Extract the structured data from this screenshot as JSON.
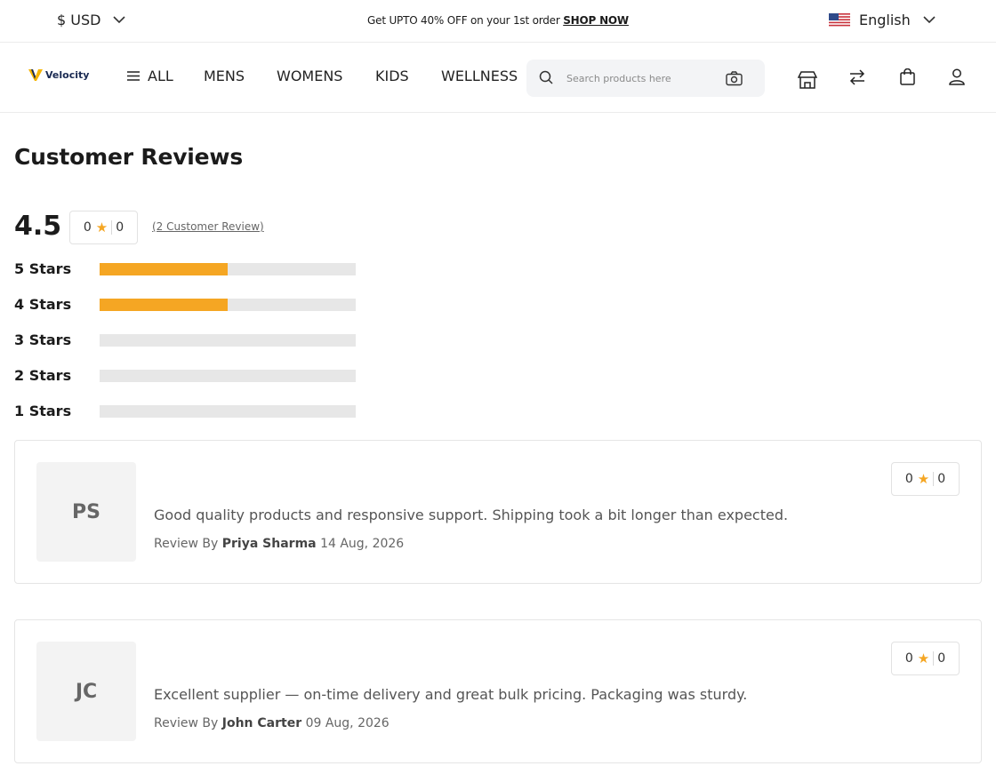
{
  "topbar": {
    "currency": "$ USD",
    "promo_text": "Get UPTO 40% OFF on your 1st order",
    "promo_link": "SHOP NOW",
    "language": "English"
  },
  "nav": {
    "brand": "Velocity",
    "all_label": "ALL",
    "items": [
      "MENS",
      "WOMENS",
      "KIDS",
      "WELLNESS"
    ],
    "search_placeholder": "Search products here"
  },
  "reviews": {
    "title": "Customer Reviews",
    "average": "4.5",
    "summary_votes": {
      "up": "0",
      "down": "0"
    },
    "count_text": "(2 Customer Review)",
    "breakdown": [
      {
        "label": "5 Stars",
        "fraction": 0.5
      },
      {
        "label": "4 Stars",
        "fraction": 0.5
      },
      {
        "label": "3 Stars",
        "fraction": 0
      },
      {
        "label": "2 Stars",
        "fraction": 0
      },
      {
        "label": "1 Stars",
        "fraction": 0
      }
    ],
    "items": [
      {
        "initials": "PS",
        "text": "Good quality products and responsive support. Shipping took a bit longer than expected.",
        "by_label": "Review By",
        "author": "Priya Sharma",
        "date": "14 Aug, 2026",
        "votes": {
          "up": "0",
          "down": "0"
        }
      },
      {
        "initials": "JC",
        "text": "Excellent supplier — on-time delivery and great bulk pricing. Packaging was sturdy.",
        "by_label": "Review By",
        "author": "John Carter",
        "date": "09 Aug, 2026",
        "votes": {
          "up": "0",
          "down": "0"
        }
      }
    ]
  },
  "colors": {
    "accent": "#f5a623",
    "track": "#e7e7e7"
  },
  "icons": [
    "chevron-down-icon",
    "us-flag-icon",
    "menu-icon",
    "search-icon",
    "camera-icon",
    "store-icon",
    "compare-icon",
    "bag-icon",
    "user-icon",
    "star-icon"
  ]
}
